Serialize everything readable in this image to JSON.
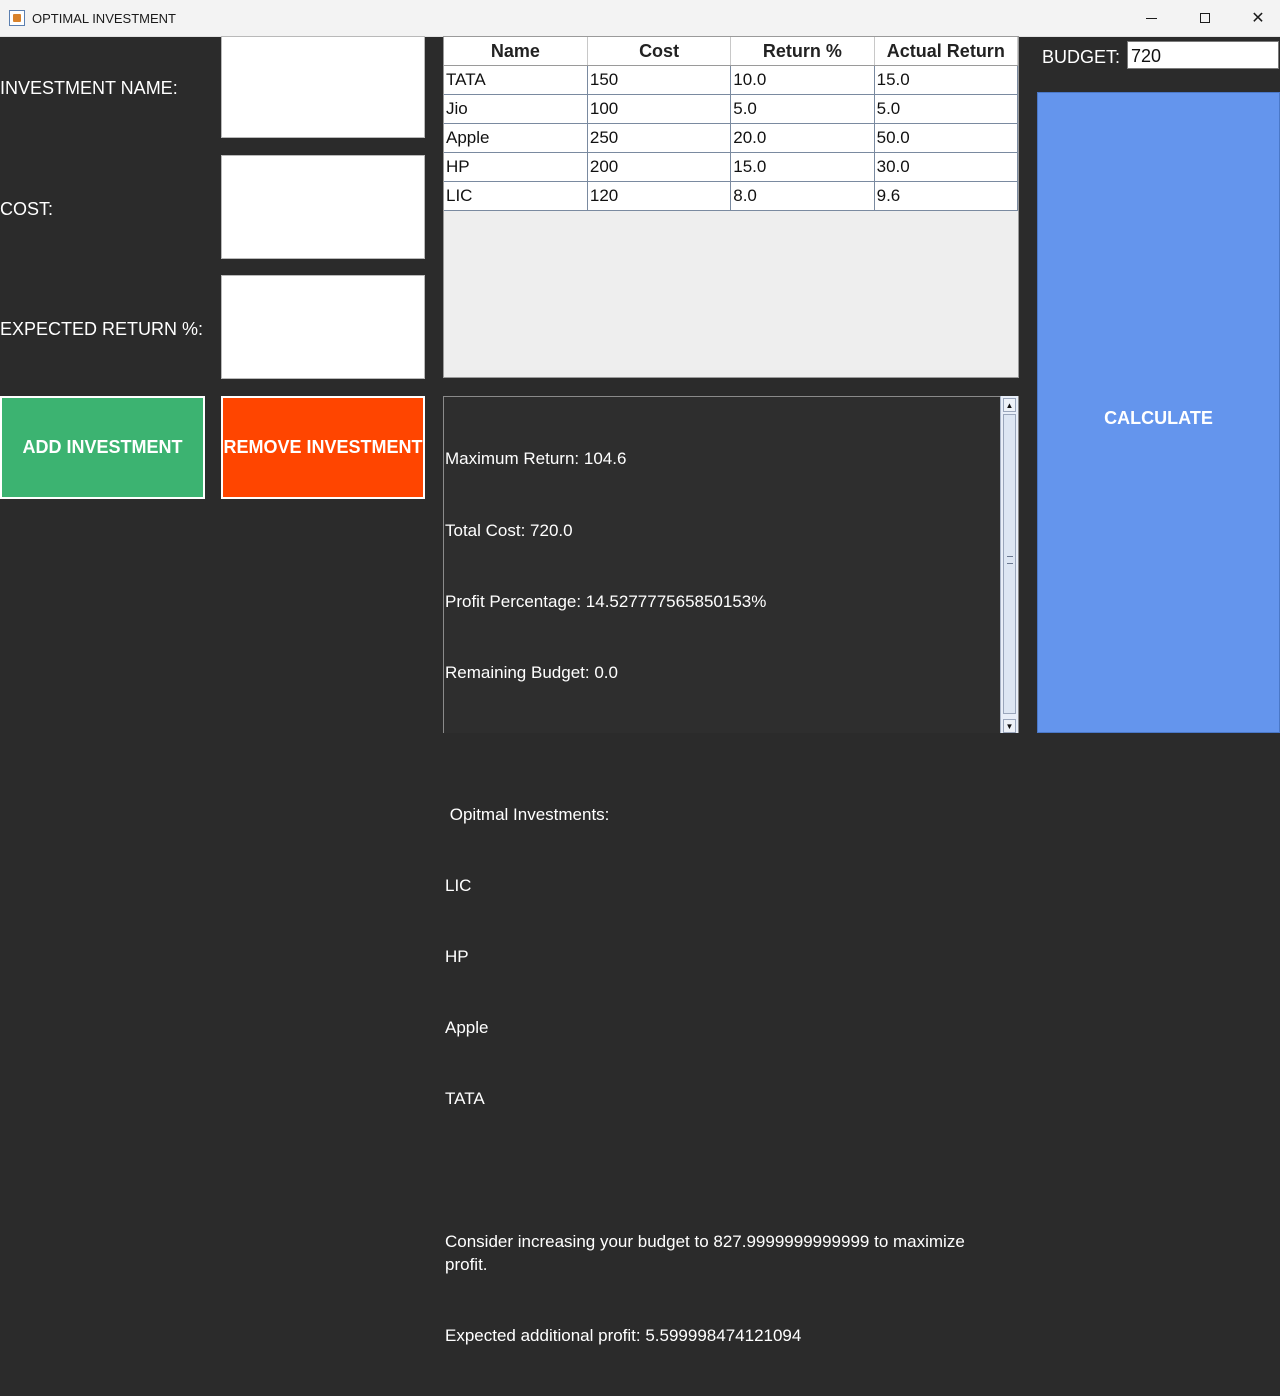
{
  "window": {
    "title": "OPTIMAL INVESTMENT",
    "app_icon": "java-cup-icon",
    "controls": {
      "minimize": "minimize-icon",
      "maximize": "maximize-icon",
      "close": "✕"
    }
  },
  "form": {
    "name_label": "INVESTMENT NAME:",
    "cost_label": "COST:",
    "return_label": "EXPECTED RETURN %:",
    "name_value": "",
    "cost_value": "",
    "return_value": ""
  },
  "buttons": {
    "add": "ADD INVESTMENT",
    "remove": "REMOVE INVESTMENT",
    "calculate": "CALCULATE"
  },
  "colors": {
    "add_button": "#3cb371",
    "remove_button": "#ff4500",
    "calculate_button": "#6495ed",
    "background": "#2b2b2b"
  },
  "table": {
    "columns": [
      "Name",
      "Cost",
      "Return %",
      "Actual Return"
    ],
    "rows": [
      [
        "TATA",
        "150",
        "10.0",
        "15.0"
      ],
      [
        "Jio",
        "100",
        "5.0",
        "5.0"
      ],
      [
        "Apple",
        "250",
        "20.0",
        "50.0"
      ],
      [
        "HP",
        "200",
        "15.0",
        "30.0"
      ],
      [
        "LIC",
        "120",
        "8.0",
        "9.6"
      ]
    ]
  },
  "budget": {
    "label": "BUDGET:",
    "value": "720"
  },
  "results": {
    "lines": [
      "Maximum Return: 104.6",
      "Total Cost: 720.0",
      "Profit Percentage: 14.527777565850153%",
      "Remaining Budget: 0.0",
      "",
      " Opitmal Investments:",
      "LIC",
      "HP",
      "Apple",
      "TATA",
      "",
      "Consider increasing your budget to 827.9999999999999 to maximize profit.",
      "Expected additional profit: 5.599998474121094"
    ]
  }
}
